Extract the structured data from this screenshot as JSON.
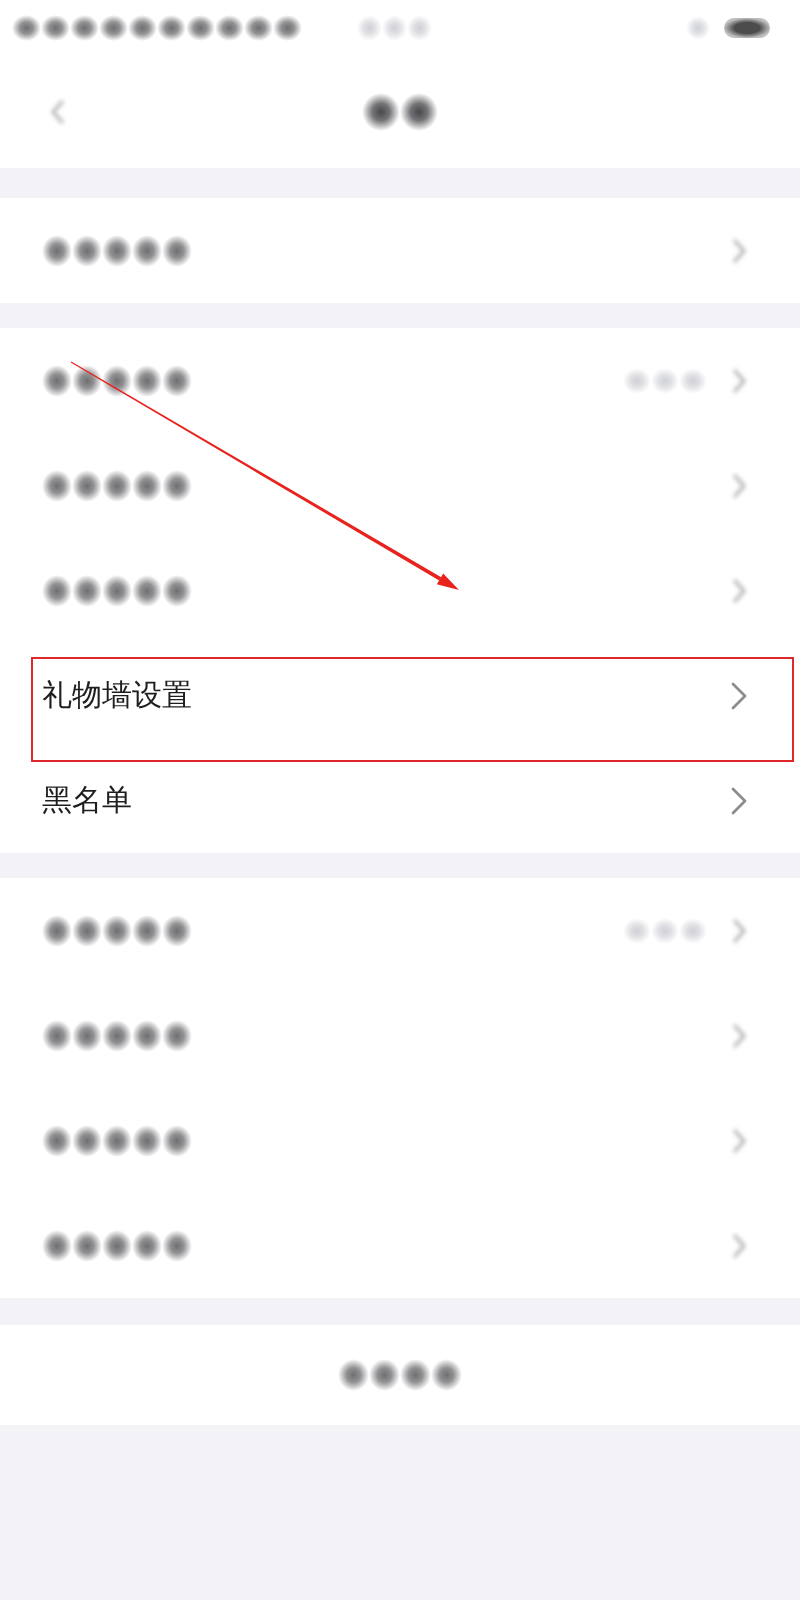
{
  "status_bar": {
    "kind": "blurred"
  },
  "nav_bar": {
    "back": true,
    "title": {
      "kind": "blurred"
    }
  },
  "sections": [
    {
      "items": [
        {
          "kind": "blurred"
        }
      ]
    },
    {
      "items": [
        {
          "kind": "blurred",
          "value": {
            "kind": "blurred"
          }
        },
        {
          "kind": "blurred"
        },
        {
          "kind": "blurred"
        },
        {
          "kind": "link",
          "label": "礼物墙设置",
          "highlighted": true
        },
        {
          "kind": "link",
          "label": "黑名单",
          "highlighted": false
        }
      ]
    },
    {
      "items": [
        {
          "kind": "blurred",
          "value": {
            "kind": "blurred"
          }
        },
        {
          "kind": "blurred"
        },
        {
          "kind": "blurred"
        },
        {
          "kind": "blurred"
        }
      ]
    }
  ],
  "bottom_button": {
    "kind": "blurred"
  },
  "annotations": [
    {
      "kind": "arrow"
    }
  ]
}
